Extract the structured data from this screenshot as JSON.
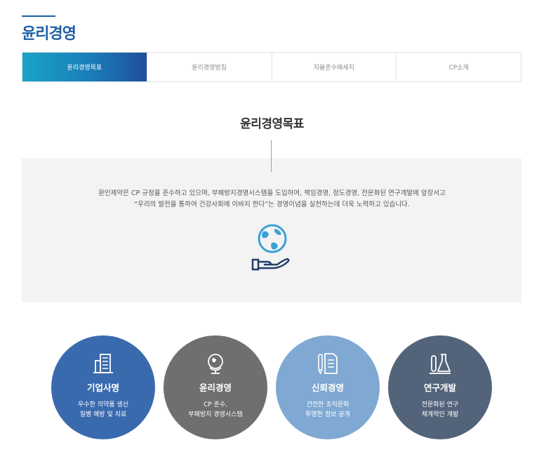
{
  "header": {
    "title": "윤리경영"
  },
  "tabs": [
    {
      "label": "윤리경영목표",
      "active": true
    },
    {
      "label": "윤리경영방침",
      "active": false
    },
    {
      "label": "자율준수메세지",
      "active": false
    },
    {
      "label": "CP소개",
      "active": false
    }
  ],
  "section": {
    "heading": "윤리경영목표",
    "description_lines": [
      "환인제약은 CP 규정을 준수하고 있으며, 부패방지경영시스템을 도입하여, 책임경영, 정도경영, 전문화된 연구개발에 앞장서고",
      "“우리의 발전을 통하여 건강사회에 이바지 한다”는 경영이념을 실천하는데 더욱 노력하고 있습니다."
    ]
  },
  "values": [
    {
      "title": "기업사명",
      "lines": [
        "우수한 의약품 생산",
        "질병 예방 및 치료"
      ],
      "icon": "building-icon"
    },
    {
      "title": "윤리경영",
      "lines": [
        "CP 준수,",
        "부패방지 경영시스템"
      ],
      "icon": "globe-icon"
    },
    {
      "title": "신뢰경영",
      "lines": [
        "건전한 조직문화",
        "투명한 정보 공개"
      ],
      "icon": "document-icon"
    },
    {
      "title": "연구개발",
      "lines": [
        "전문화된 연구",
        "체계적인 개발"
      ],
      "icon": "flask-icon"
    }
  ],
  "colors": {
    "accent": "#1f5fa6",
    "tab_active_start": "#1aa3c6",
    "tab_active_end": "#1f4f9a",
    "circle_1": "#3a6aae",
    "circle_2": "#6f6f6f",
    "circle_3": "#7fa8d2",
    "circle_4": "#53647a",
    "panel_bg": "#f3f3f3"
  }
}
